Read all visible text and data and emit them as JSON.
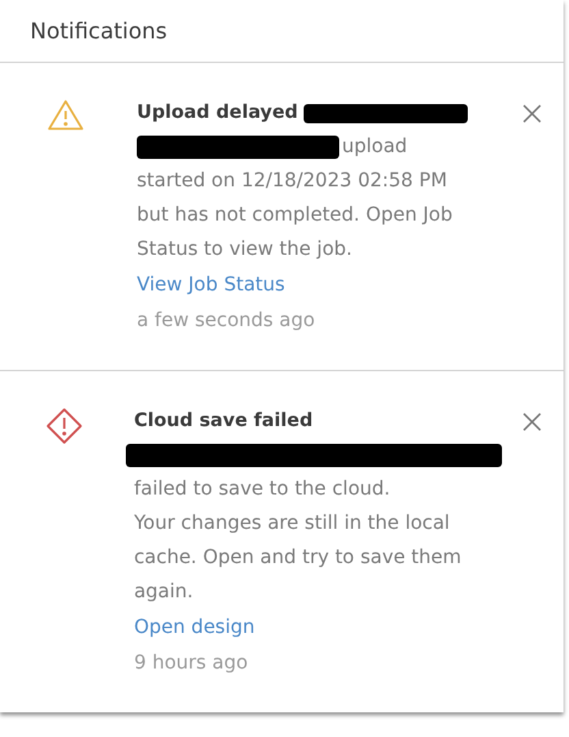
{
  "panel": {
    "title": "Notifications"
  },
  "notifications": [
    {
      "kind": "warning",
      "title": "Upload delayed",
      "title_redacted": true,
      "lead_redacted": true,
      "lead_tail": "upload",
      "lines": [
        "started on 12/18/2023 02:58 PM",
        "but has not completed. Open Job",
        "Status to view the job."
      ],
      "link": "View Job Status",
      "time": "a few seconds ago"
    },
    {
      "kind": "error",
      "title": "Cloud save failed",
      "title_redacted": false,
      "lead_redacted": true,
      "lines": [
        "failed to save to the cloud.",
        "Your changes are still in the local",
        "cache. Open and try to save them",
        "again."
      ],
      "link": "Open design",
      "time": "9 hours ago"
    }
  ]
}
